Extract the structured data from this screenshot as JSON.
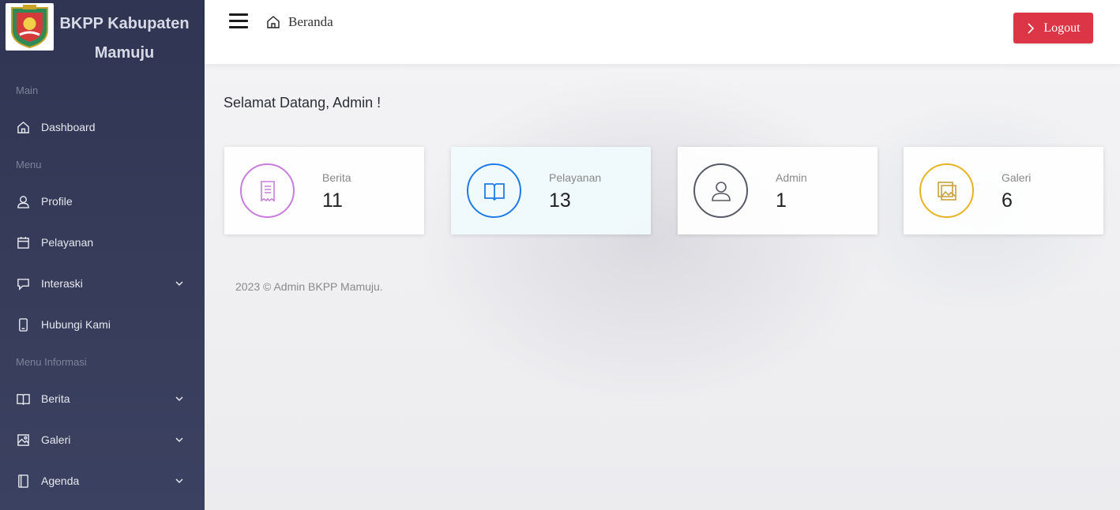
{
  "brand": {
    "title": "BKPP Kabupaten Mamuju",
    "logo_icon": "regency-crest-icon"
  },
  "sidebar": {
    "sections": [
      {
        "label": "Main"
      },
      {
        "label": "Menu"
      },
      {
        "label": "Menu Informasi"
      }
    ],
    "items": [
      {
        "label": "Dashboard",
        "icon": "home-icon",
        "has_submenu": false
      },
      {
        "label": "Profile",
        "icon": "user-icon",
        "has_submenu": false
      },
      {
        "label": "Pelayanan",
        "icon": "calendar-icon",
        "has_submenu": false
      },
      {
        "label": "Interaski",
        "icon": "chat-icon",
        "has_submenu": true
      },
      {
        "label": "Hubungi Kami",
        "icon": "phone-icon",
        "has_submenu": false
      },
      {
        "label": "Berita",
        "icon": "book-icon",
        "has_submenu": true
      },
      {
        "label": "Galeri",
        "icon": "image-icon",
        "has_submenu": true
      },
      {
        "label": "Agenda",
        "icon": "notebook-icon",
        "has_submenu": true
      }
    ]
  },
  "topbar": {
    "breadcrumb": "Beranda",
    "logout_label": "Logout"
  },
  "main": {
    "welcome": "Selamat Datang, Admin !",
    "cards": [
      {
        "label": "Berita",
        "value": "11",
        "icon": "receipt-icon",
        "color": "#c77ddb"
      },
      {
        "label": "Pelayanan",
        "value": "13",
        "icon": "book-open-icon",
        "color": "#1e7be6"
      },
      {
        "label": "Admin",
        "value": "1",
        "icon": "user-icon",
        "color": "#555a63"
      },
      {
        "label": "Galeri",
        "value": "6",
        "icon": "gallery-icon",
        "color": "#e6b422"
      }
    ],
    "footer": "2023 © Admin BKPP Mamuju."
  },
  "colors": {
    "sidebar_bg": "#323856",
    "logout_bg": "#dc3545"
  }
}
